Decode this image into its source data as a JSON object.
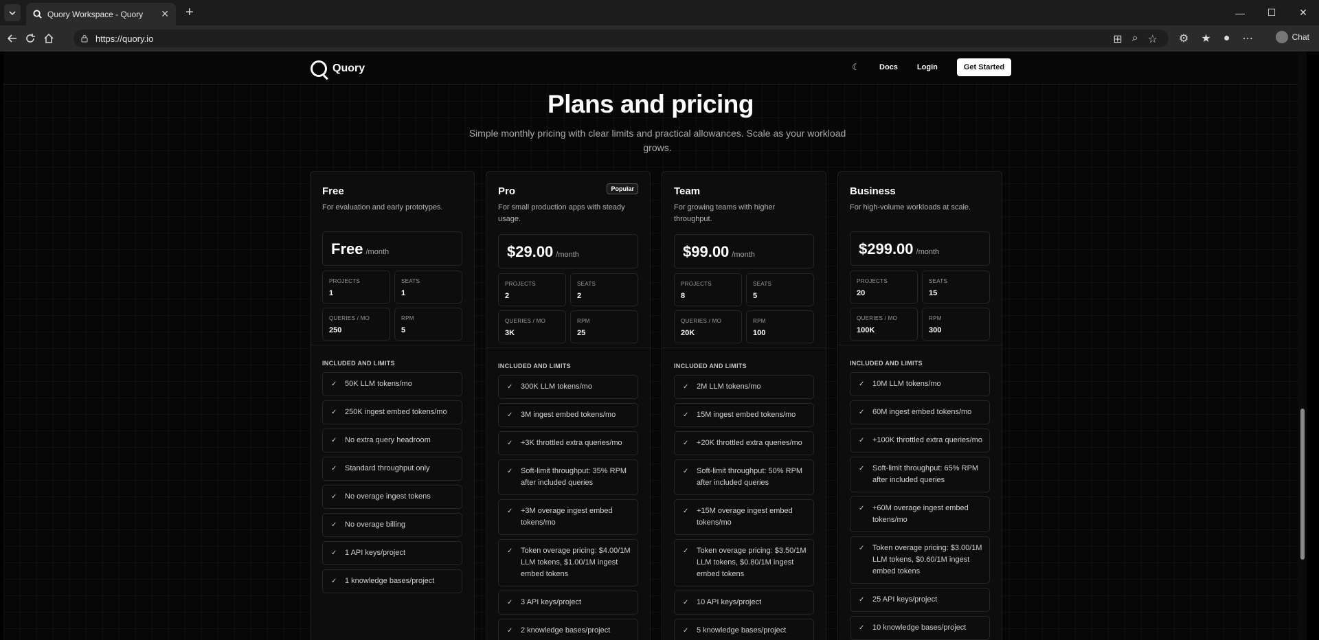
{
  "browser": {
    "tab_title": "Quory Workspace - Quory",
    "url": "https://quory.io",
    "chat_label": "Chat"
  },
  "header": {
    "logo_text": "Quory",
    "docs": "Docs",
    "login": "Login",
    "get_started": "Get Started"
  },
  "hero": {
    "title": "Plans and pricing",
    "subtitle": "Simple monthly pricing with clear limits and practical allowances. Scale as your workload grows."
  },
  "plans": [
    {
      "name": "Free",
      "badge": "",
      "desc": "For evaluation and early prototypes.",
      "price": "Free",
      "per": "/month",
      "stats": [
        {
          "label": "PROJECTS",
          "value": "1"
        },
        {
          "label": "SEATS",
          "value": "1"
        },
        {
          "label": "QUERIES / MO",
          "value": "250"
        },
        {
          "label": "RPM",
          "value": "5"
        }
      ],
      "included_title": "INCLUDED AND LIMITS",
      "features": [
        "50K LLM tokens/mo",
        "250K ingest embed tokens/mo",
        "No extra query headroom",
        "Standard throughput only",
        "No overage ingest tokens",
        "No overage billing",
        "1 API keys/project",
        "1 knowledge bases/project"
      ]
    },
    {
      "name": "Pro",
      "badge": "Popular",
      "desc": "For small production apps with steady usage.",
      "price": "$29.00",
      "per": "/month",
      "stats": [
        {
          "label": "PROJECTS",
          "value": "2"
        },
        {
          "label": "SEATS",
          "value": "2"
        },
        {
          "label": "QUERIES / MO",
          "value": "3K"
        },
        {
          "label": "RPM",
          "value": "25"
        }
      ],
      "included_title": "INCLUDED AND LIMITS",
      "features": [
        "300K LLM tokens/mo",
        "3M ingest embed tokens/mo",
        "+3K throttled extra queries/mo",
        "Soft-limit throughput: 35% RPM after included queries",
        "+3M overage ingest embed tokens/mo",
        "Token overage pricing: $4.00/1M LLM tokens, $1.00/1M ingest embed tokens",
        "3 API keys/project",
        "2 knowledge bases/project"
      ]
    },
    {
      "name": "Team",
      "badge": "",
      "desc": "For growing teams with higher throughput.",
      "price": "$99.00",
      "per": "/month",
      "stats": [
        {
          "label": "PROJECTS",
          "value": "8"
        },
        {
          "label": "SEATS",
          "value": "5"
        },
        {
          "label": "QUERIES / MO",
          "value": "20K"
        },
        {
          "label": "RPM",
          "value": "100"
        }
      ],
      "included_title": "INCLUDED AND LIMITS",
      "features": [
        "2M LLM tokens/mo",
        "15M ingest embed tokens/mo",
        "+20K throttled extra queries/mo",
        "Soft-limit throughput: 50% RPM after included queries",
        "+15M overage ingest embed tokens/mo",
        "Token overage pricing: $3.50/1M LLM tokens, $0.80/1M ingest embed tokens",
        "10 API keys/project",
        "5 knowledge bases/project"
      ]
    },
    {
      "name": "Business",
      "badge": "",
      "desc": "For high-volume workloads at scale.",
      "price": "$299.00",
      "per": "/month",
      "stats": [
        {
          "label": "PROJECTS",
          "value": "20"
        },
        {
          "label": "SEATS",
          "value": "15"
        },
        {
          "label": "QUERIES / MO",
          "value": "100K"
        },
        {
          "label": "RPM",
          "value": "300"
        }
      ],
      "included_title": "INCLUDED AND LIMITS",
      "features": [
        "10M LLM tokens/mo",
        "60M ingest embed tokens/mo",
        "+100K throttled extra queries/mo",
        "Soft-limit throughput: 65% RPM after included queries",
        "+60M overage ingest embed tokens/mo",
        "Token overage pricing: $3.00/1M LLM tokens, $0.60/1M ingest embed tokens",
        "25 API keys/project",
        "10 knowledge bases/project"
      ]
    }
  ]
}
